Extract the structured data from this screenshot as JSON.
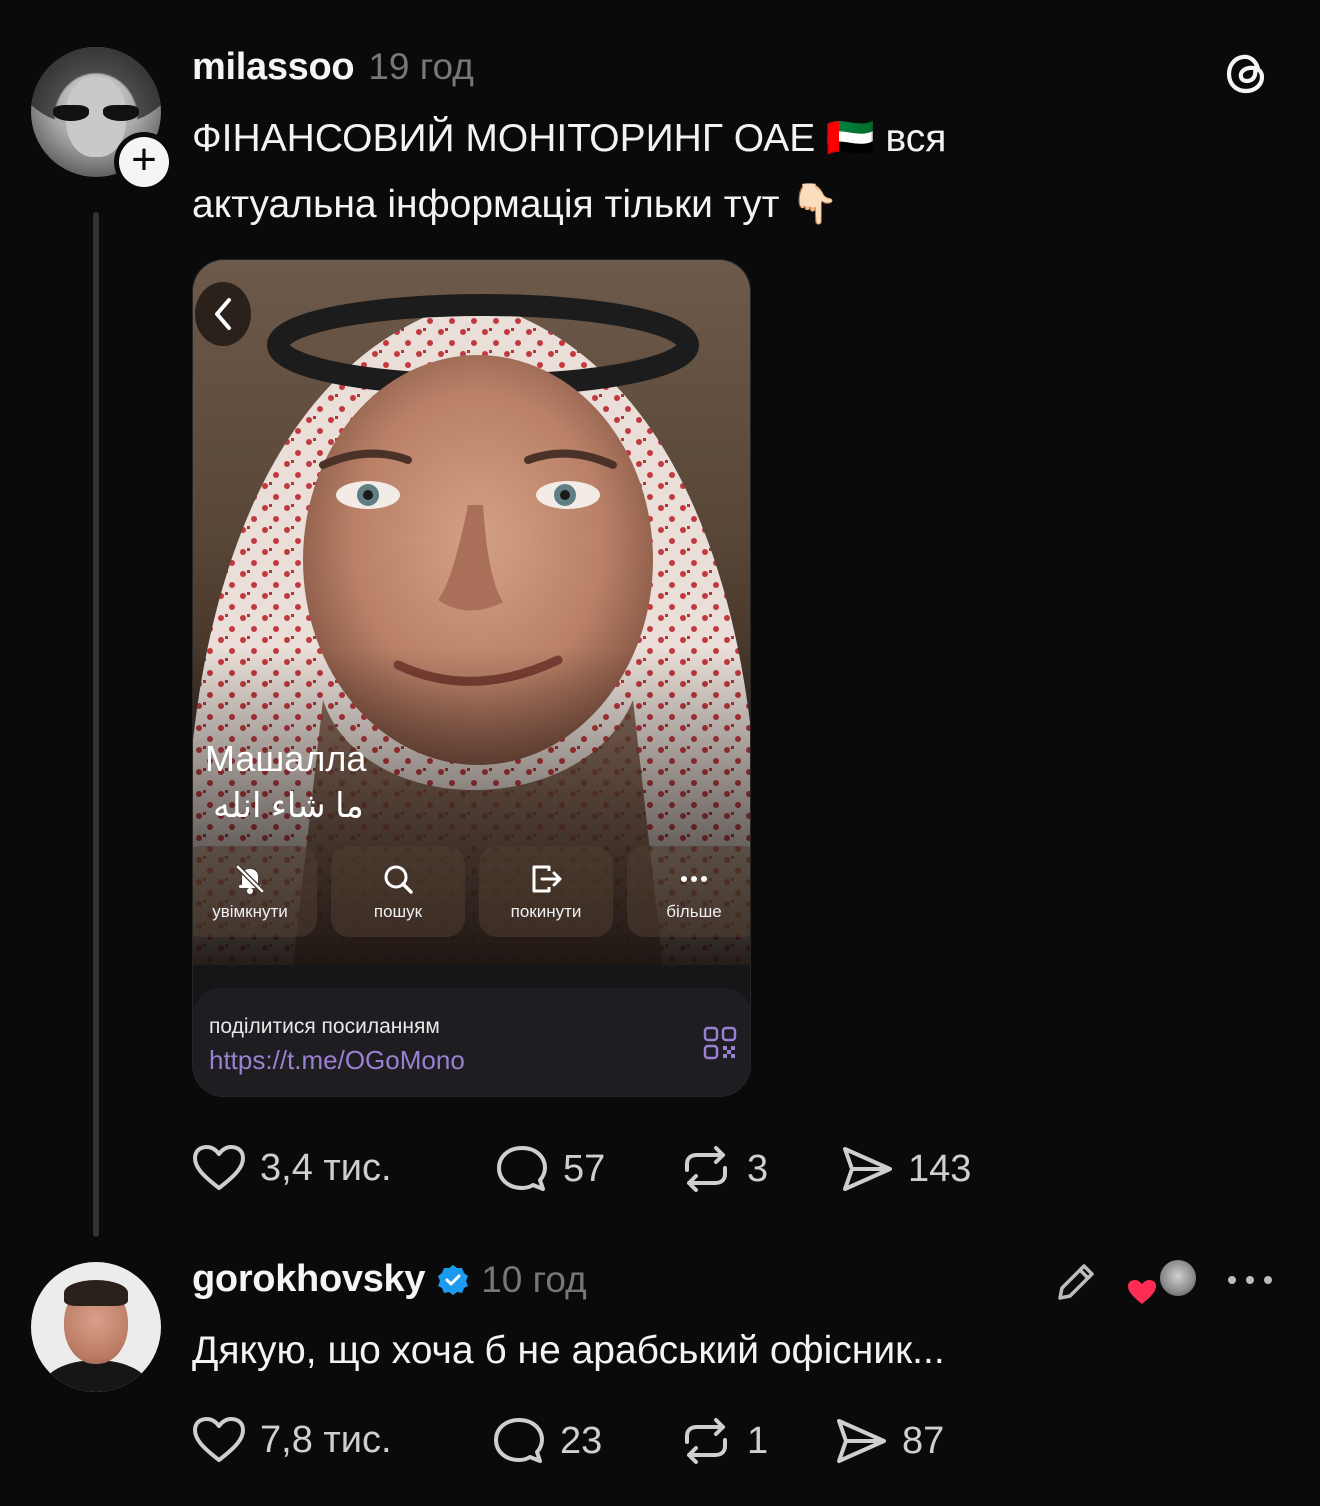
{
  "post1": {
    "username": "milassoo",
    "time": "19 год",
    "text_line1": "ФІНАНСОВИЙ МОНІТОРИНГ ОАЕ 🇦🇪 вся",
    "text_line2": "актуальна інформація тільки тут 👇🏻",
    "card": {
      "title": "Машалла",
      "subtitle": "ما شاء انله",
      "actions": [
        {
          "label": "увімкнути",
          "icon": "bell-slash-icon"
        },
        {
          "label": "пошук",
          "icon": "search-icon"
        },
        {
          "label": "покинути",
          "icon": "leave-icon"
        },
        {
          "label": "більше",
          "icon": "more-icon"
        }
      ],
      "share_label": "поділитися посиланням",
      "share_link": "https://t.me/OGoMono"
    },
    "stats": {
      "likes": "3,4 тис.",
      "replies": "57",
      "reposts": "3",
      "shares": "143"
    }
  },
  "post2": {
    "username": "gorokhovsky",
    "time": "10 год",
    "text": "Дякую, що хоча б не арабський офісник...",
    "stats": {
      "likes": "7,8 тис.",
      "replies": "23",
      "reposts": "1",
      "shares": "87"
    }
  },
  "colors": {
    "background": "#0a0a0a",
    "muted": "#777777",
    "link": "#9b7fd1",
    "verified": "#1d9bf0",
    "heart": "#ff2d55"
  }
}
